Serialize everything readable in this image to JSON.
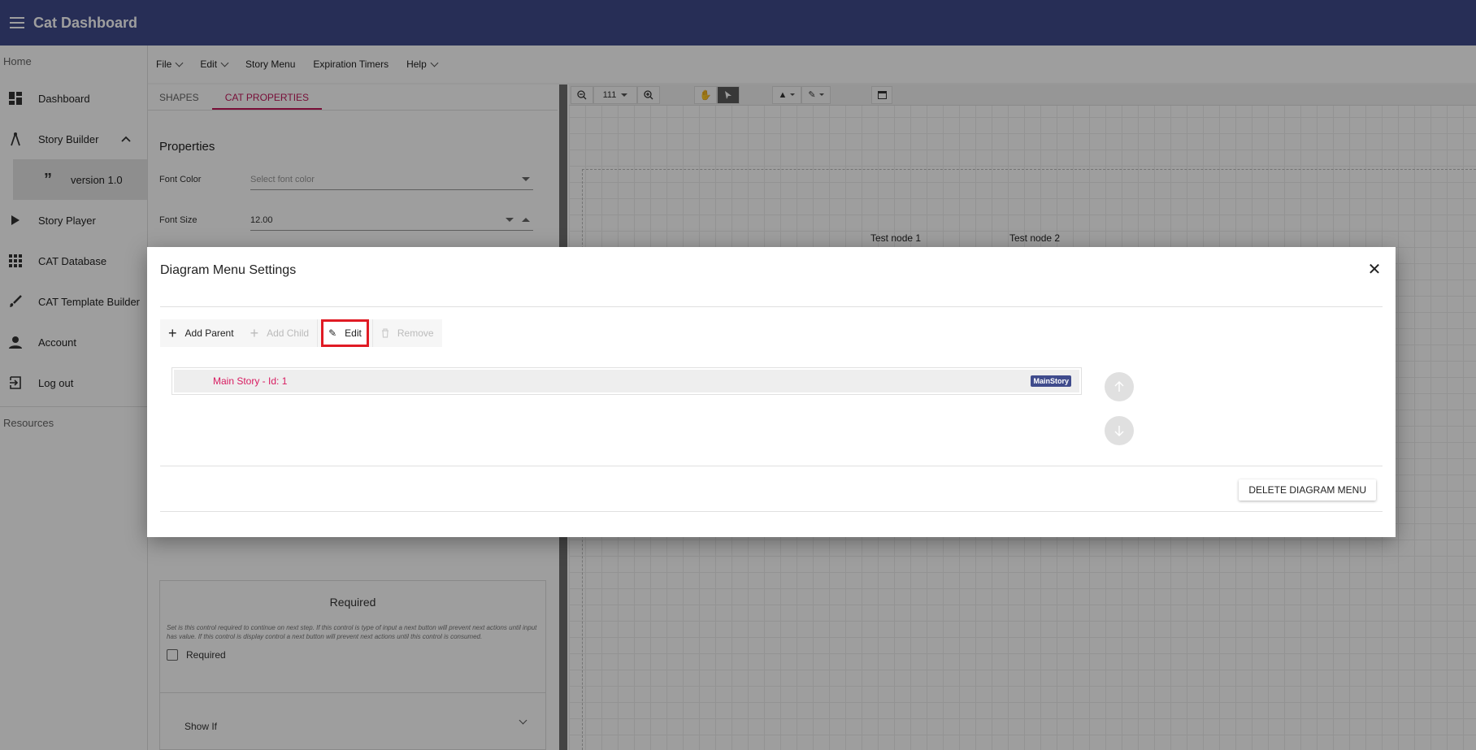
{
  "app": {
    "title": "Cat Dashboard"
  },
  "sidebar": {
    "home_label": "Home",
    "items": [
      {
        "label": "Dashboard",
        "icon": "dashboard-icon"
      },
      {
        "label": "Story Builder",
        "icon": "compass-icon"
      },
      {
        "label": "version 1.0",
        "icon": "quote-icon"
      },
      {
        "label": "Story Player",
        "icon": "play-icon"
      },
      {
        "label": "CAT Database",
        "icon": "grid-icon"
      },
      {
        "label": "CAT Template Builder",
        "icon": "brush-icon"
      },
      {
        "label": "Account",
        "icon": "person-icon"
      },
      {
        "label": "Log out",
        "icon": "logout-icon"
      }
    ],
    "resources_label": "Resources"
  },
  "menubar": {
    "file": "File",
    "edit": "Edit",
    "story_menu": "Story Menu",
    "expiration_timers": "Expiration Timers",
    "help": "Help"
  },
  "props_panel": {
    "tabs": [
      "SHAPES",
      "CAT PROPERTIES"
    ],
    "active_tab": "CAT PROPERTIES",
    "heading": "Properties",
    "font_color_label": "Font Color",
    "font_color_placeholder": "Select font color",
    "font_size_label": "Font Size",
    "font_size_value": "12.00",
    "required_title": "Required",
    "required_desc": "Set is this control required to continue on next step. If this control is type of input a next button will prevent next actions until input has value. If this control is display control a next button will prevent next actions until this control is consumed.",
    "required_checkbox_label": "Required",
    "show_if_label": "Show If"
  },
  "canvas": {
    "zoom_value": "111",
    "node_1": "Test node 1",
    "node_2": "Test node 2"
  },
  "dialog": {
    "title": "Diagram Menu Settings",
    "toolbar": {
      "add_parent": "Add Parent",
      "add_child": "Add Child",
      "edit": "Edit",
      "remove": "Remove"
    },
    "list_items": [
      {
        "label": "Main Story - Id: 1",
        "badge": "MainStory"
      }
    ],
    "delete_button": "DELETE DIAGRAM MENU"
  },
  "colors": {
    "primary": "#3f4b8c",
    "accent": "#d81b60",
    "highlight": "#e01b24"
  }
}
